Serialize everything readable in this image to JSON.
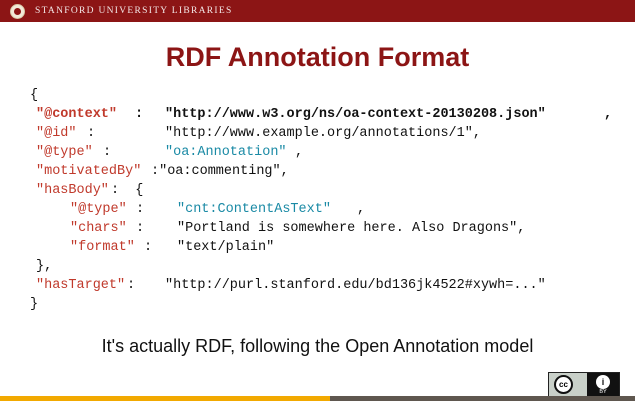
{
  "header": {
    "label": "STANFORD UNIVERSITY LIBRARIES"
  },
  "slide": {
    "title": "RDF Annotation Format",
    "code": {
      "open_brace": "{",
      "context_key": "\"@context\"",
      "context_colon": ":",
      "context_value": "\"http://www.w3.org/ns/oa-context-20130208.json\"",
      "context_comma": ",",
      "id_key": "\"@id\"",
      "id_colon": ":",
      "id_value": "\"http://www.example.org/annotations/1\",",
      "type_key": "\"@type\"",
      "type_colon": ":",
      "type_value": "\"oa:Annotation\"",
      "type_comma": ",",
      "motivated_key": "\"motivatedBy\"",
      "motivated_rest": ":\"oa:commenting\",",
      "hasbody_key": "\"hasBody\"",
      "hasbody_rest": ":  {",
      "body_type_key": "\"@type\"",
      "body_type_colon": ":",
      "body_type_value": "\"cnt:ContentAsText\"",
      "body_type_comma": ",",
      "chars_key": "\"chars\"",
      "chars_colon": ":",
      "chars_value": "\"Portland is somewhere here. Also Dragons\",",
      "format_key": "\"format\"",
      "format_colon": ":",
      "format_value": "\"text/plain\"",
      "close_body": "},",
      "hastarget_key": "\"hasTarget\"",
      "hastarget_colon": ":",
      "hastarget_value": "\"http://purl.stanford.edu/bd136jk4522#xywh=...\"",
      "close_brace": "}"
    },
    "caption": "It's actually RDF, following the Open Annotation model"
  },
  "license_badge": {
    "cc_glyph": "cc",
    "person_glyph": "i",
    "by_label": "BY"
  },
  "colors": {
    "stanford_red": "#8c1515",
    "key_color": "#c0392b",
    "string_color": "#1a8aa5",
    "footer_gold": "#f2a900",
    "footer_gray": "#5f574f"
  },
  "icons": {
    "seal": "stanford-seal-icon",
    "license": "cc-by-icon"
  }
}
